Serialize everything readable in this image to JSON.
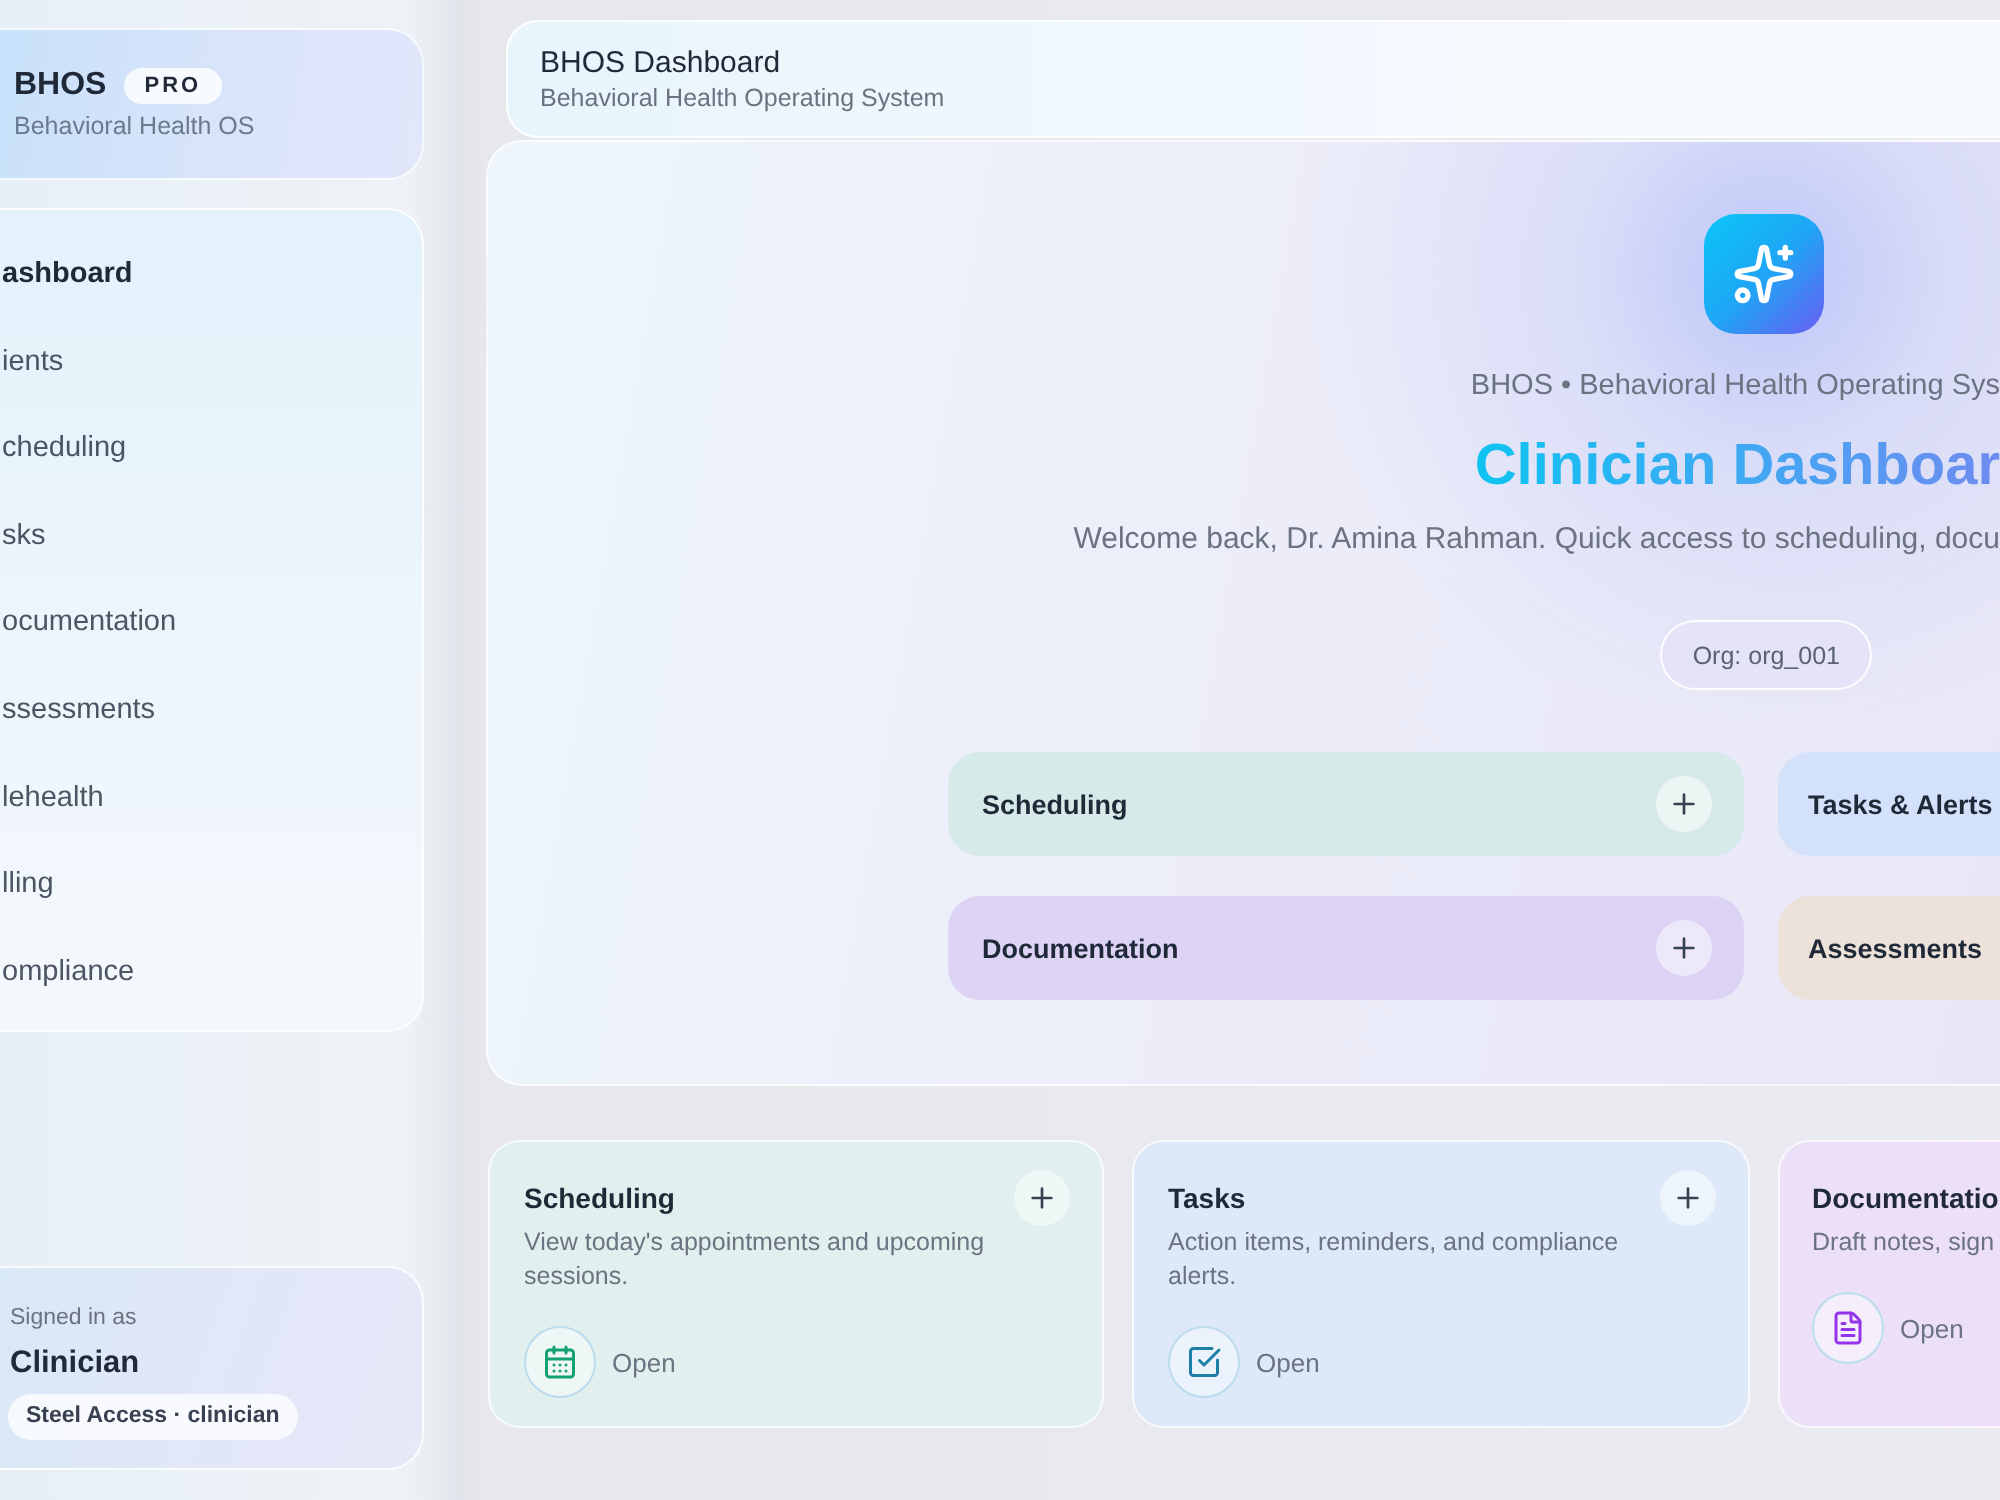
{
  "brand": {
    "name": "BHOS",
    "badge": "PRO",
    "subtitle": "Behavioral Health OS"
  },
  "sidebar": {
    "items": [
      {
        "label": "ashboard",
        "selected": true
      },
      {
        "label": "ients",
        "selected": false
      },
      {
        "label": "cheduling",
        "selected": false
      },
      {
        "label": "sks",
        "selected": false
      },
      {
        "label": "ocumentation",
        "selected": false
      },
      {
        "label": "ssessments",
        "selected": false
      },
      {
        "label": "lehealth",
        "selected": false
      },
      {
        "label": "lling",
        "selected": false
      },
      {
        "label": "ompliance",
        "selected": false
      }
    ]
  },
  "user": {
    "caption": "Signed in as",
    "role": "Clinician",
    "access": "Steel Access · clinician"
  },
  "header": {
    "title": "BHOS Dashboard",
    "subtitle": "Behavioral Health Operating System"
  },
  "hero": {
    "kicker": "BHOS • Behavioral Health Operating Sys",
    "title": "Clinician Dashboar",
    "welcome": "Welcome back, Dr. Amina Rahman. Quick access to scheduling, docu",
    "org": "Org: org_001",
    "quick_actions": [
      {
        "label": "Scheduling",
        "color": "#d6ebe9",
        "plus_button": true
      },
      {
        "label": "Tasks & Alerts",
        "color": "#d3e2fa",
        "plus_button": false
      },
      {
        "label": "Documentation",
        "color": "#ddd3f4",
        "plus_button": true
      },
      {
        "label": "Assessments",
        "color": "#ece2da",
        "plus_button": false
      }
    ]
  },
  "modules": [
    {
      "kind": "schedule",
      "title": "Scheduling",
      "description": "View today's appointments and upcoming sessions.",
      "action": "Open",
      "color": "#e1f0ee",
      "plus_button": true
    },
    {
      "kind": "task",
      "title": "Tasks",
      "description": "Action items, reminders, and compliance alerts.",
      "action": "Open",
      "color": "#dde8f8",
      "plus_button": true
    },
    {
      "kind": "document",
      "title": "Documentatio",
      "description": "Draft notes, sign",
      "action": "Open",
      "color": "#ebe0f7",
      "plus_button": false
    }
  ]
}
